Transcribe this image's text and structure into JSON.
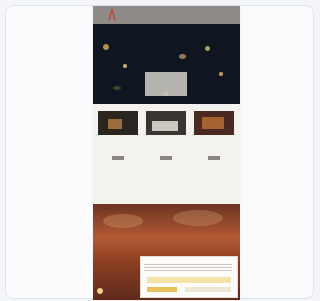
{
  "hero": {
    "title": "",
    "subtitle": ""
  },
  "features": [
    {
      "subtitle": "",
      "title": "",
      "text": "",
      "button_label": ""
    },
    {
      "subtitle": "",
      "title": "",
      "text": "",
      "button_label": ""
    },
    {
      "subtitle": "",
      "title": "",
      "text": "",
      "button_label": ""
    }
  ],
  "banner": {
    "heading": ""
  },
  "cookie": {
    "title": "",
    "accept_label": "",
    "settings_label": ""
  },
  "colors": {
    "accent": "#e6c35a",
    "banner": "#b25a34",
    "topbar": "#8f8a86",
    "logo": "#c0392b"
  },
  "icons": {
    "logo": "logo-icon",
    "chat": "chat-icon"
  }
}
